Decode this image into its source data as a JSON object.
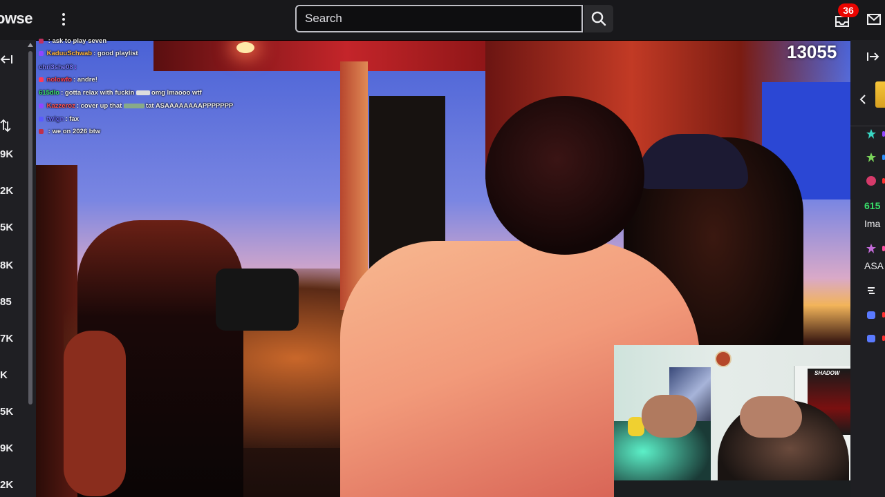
{
  "topbar": {
    "browse_label": "owse",
    "search": {
      "placeholder": "Search",
      "value": ""
    },
    "notification_count": "36"
  },
  "left_sidebar": {
    "counts": [
      "9K",
      "2K",
      "5K",
      "8K",
      "85",
      "7K",
      "K",
      "5K",
      "9K",
      "2K"
    ]
  },
  "video": {
    "viewer_count": "13055",
    "chat": [
      {
        "name": "",
        "message": ": ask to play seven"
      },
      {
        "name": "KaduuSchwab",
        "message": ": good playlist"
      },
      {
        "name": "chri3she08",
        "message": ":"
      },
      {
        "name": "nolowfo",
        "message": ": andre!"
      },
      {
        "name": "615dlo",
        "message": ": gotta relax with fuckin",
        "extra": "omg lmaooo wtf"
      },
      {
        "name": "Kazzeroz",
        "message": ": cover up that",
        "extra": "tat ASAAAAAAAAPPPPPPP"
      },
      {
        "name": "twign",
        "message": ": fax"
      },
      {
        "name": "",
        "message": ": we on 2026 btw"
      }
    ],
    "cam": {
      "poster_title": "SHADOW"
    }
  },
  "right_sidebar": {
    "texts": [
      "615",
      "Ima",
      "ASA"
    ]
  },
  "colors": {
    "accent": "#9146ff",
    "badge_red": "#eb0400",
    "chat_green": "#38e06a"
  }
}
